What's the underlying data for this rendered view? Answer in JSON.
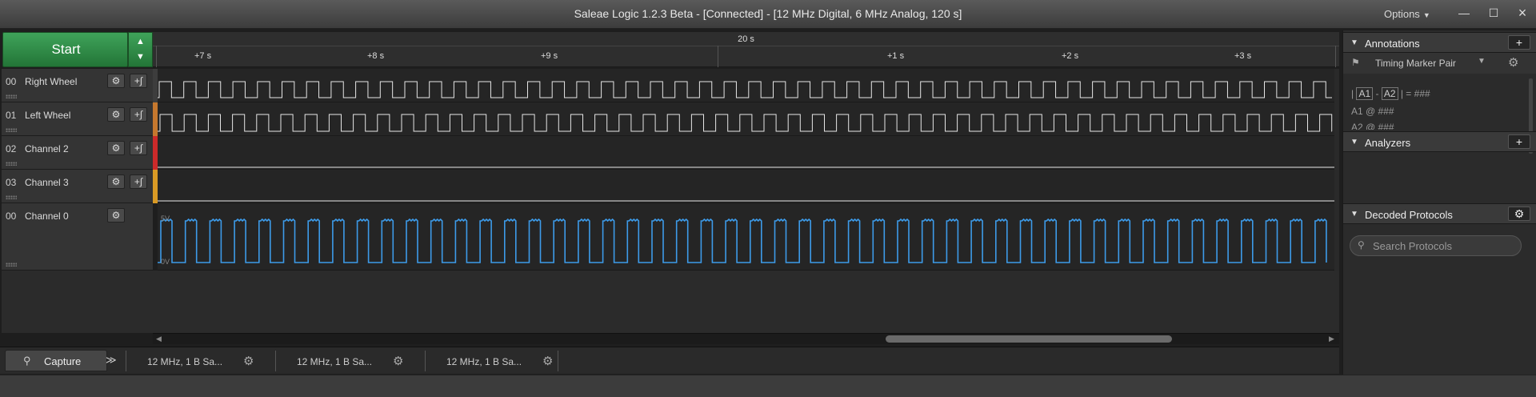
{
  "window": {
    "title": "Saleae Logic 1.2.3 Beta - [Connected] - [12 MHz Digital, 6 MHz Analog, 120 s]",
    "options_label": "Options",
    "minimize_glyph": "—",
    "maximize_glyph": "☐",
    "close_glyph": "×"
  },
  "start": {
    "label": "Start",
    "up_glyph": "▲",
    "down_glyph": "▼"
  },
  "timeline": {
    "center_label": "20 s",
    "ticks": [
      "+7 s",
      "+8 s",
      "+9 s",
      "+1 s",
      "+2 s",
      "+3 s"
    ]
  },
  "channels": [
    {
      "num": "00",
      "name": "Right Wheel",
      "gear": "⚙",
      "trigger": "+∫",
      "color": "#3d3d3d",
      "type": "digital"
    },
    {
      "num": "01",
      "name": "Left Wheel",
      "gear": "⚙",
      "trigger": "+∫",
      "color": "#c5782e",
      "type": "digital"
    },
    {
      "num": "02",
      "name": "Channel 2",
      "gear": "⚙",
      "trigger": "+∫",
      "color": "#cc2a2a",
      "type": "digital"
    },
    {
      "num": "03",
      "name": "Channel 3",
      "gear": "⚙",
      "trigger": "+∫",
      "color": "#d99a25",
      "type": "digital"
    },
    {
      "num": "00",
      "name": "Channel 0",
      "gear": "⚙",
      "type": "analog"
    }
  ],
  "analog": {
    "max_label": "5V",
    "min_label": "0V",
    "color": "#3d9be9"
  },
  "tabs": {
    "capture_label": "Capture",
    "capture_icon": "⚲",
    "more_glyph": "≫",
    "sessions": [
      "12 MHz, 1 B Sa...",
      "12 MHz, 1 B Sa...",
      "12 MHz, 1 B Sa..."
    ],
    "gear_glyph": "⚙"
  },
  "sidebar": {
    "annotations": {
      "title": "Annotations",
      "add_glyph": "+",
      "marker_name": "Timing Marker Pair",
      "lines": [
        {
          "a": "A1",
          "sep": "-",
          "b": "A2",
          "rest": "| = ###"
        },
        {
          "text": "A1  @  ###"
        },
        {
          "text": "A2  @  ###"
        }
      ]
    },
    "analyzers": {
      "title": "Analyzers",
      "add_glyph": "+"
    },
    "decoded": {
      "title": "Decoded Protocols",
      "gear_glyph": "⚙",
      "search_placeholder": "Search Protocols",
      "search_value": ""
    }
  }
}
